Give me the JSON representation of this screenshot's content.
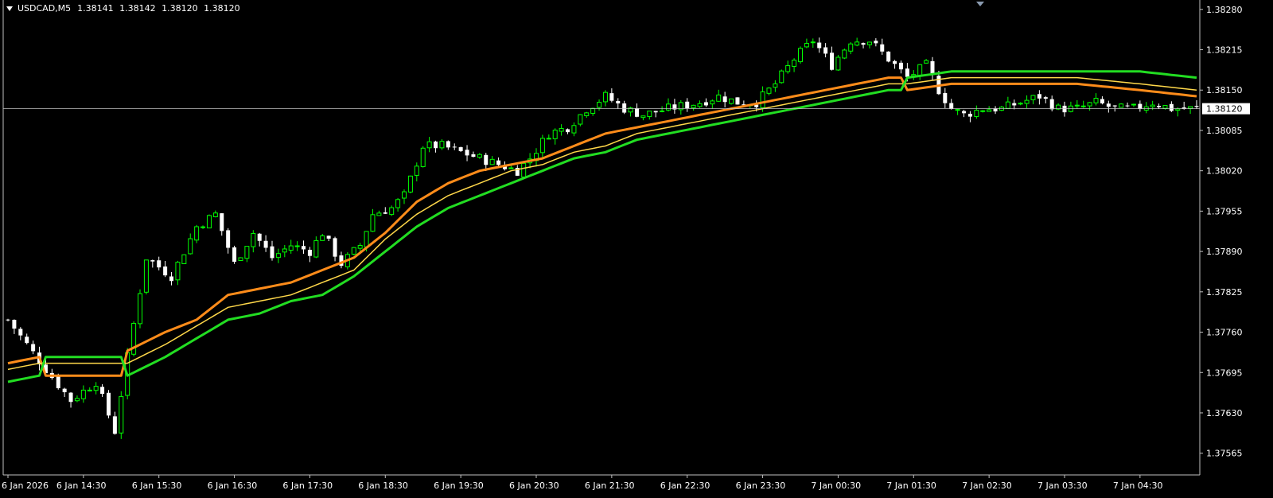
{
  "header": {
    "symbol": "USDCAD,M5",
    "open": "1.38141",
    "high": "1.38142",
    "low": "1.38120",
    "close": "1.38120"
  },
  "colors": {
    "background": "#000000",
    "bull_candle": "#00ff00",
    "bear_candle": "#ffffff",
    "axis": "#c0c0c0",
    "price_line": "#c0c0c0",
    "band_upper": "#ff8c1a",
    "band_middle": "#ffd84a",
    "band_lower": "#22dd22"
  },
  "chart_data": {
    "type": "candlestick",
    "symbol": "USDCAD",
    "timeframe": "M5",
    "ylim": [
      1.3753,
      1.3829
    ],
    "y_ticks": [
      "1.38280",
      "1.38215",
      "1.38150",
      "1.38085",
      "1.38020",
      "1.37955",
      "1.37890",
      "1.37825",
      "1.37760",
      "1.37695",
      "1.37630",
      "1.37565"
    ],
    "y_tick_values": [
      1.3828,
      1.38215,
      1.3815,
      1.38085,
      1.3802,
      1.37955,
      1.3789,
      1.37825,
      1.3776,
      1.37695,
      1.3763,
      1.37565
    ],
    "current_price": 1.3812,
    "current_price_label": "1.38120",
    "x_labels": [
      "6 Jan 2026",
      "6 Jan 14:30",
      "6 Jan 15:30",
      "6 Jan 16:30",
      "6 Jan 17:30",
      "6 Jan 18:30",
      "6 Jan 19:30",
      "6 Jan 20:30",
      "6 Jan 21:30",
      "6 Jan 22:30",
      "6 Jan 23:30",
      "7 Jan 00:30",
      "7 Jan 01:30",
      "7 Jan 02:30",
      "7 Jan 03:30",
      "7 Jan 04:30"
    ],
    "bar_count": 190,
    "ohlc_close_path": [
      [
        0,
        1.3778
      ],
      [
        6,
        1.377
      ],
      [
        10,
        1.3765
      ],
      [
        14,
        1.3768
      ],
      [
        17,
        1.376
      ],
      [
        19,
        1.3772
      ],
      [
        22,
        1.3788
      ],
      [
        26,
        1.3785
      ],
      [
        30,
        1.3793
      ],
      [
        33,
        1.3795
      ],
      [
        36,
        1.3787
      ],
      [
        39,
        1.3792
      ],
      [
        42,
        1.3788
      ],
      [
        45,
        1.379
      ],
      [
        48,
        1.3789
      ],
      [
        50,
        1.3792
      ],
      [
        53,
        1.3787
      ],
      [
        56,
        1.379
      ],
      [
        58,
        1.3795
      ],
      [
        61,
        1.3796
      ],
      [
        63,
        1.3798
      ],
      [
        66,
        1.3806
      ],
      [
        69,
        1.3806
      ],
      [
        72,
        1.3805
      ],
      [
        75,
        1.3804
      ],
      [
        78,
        1.3803
      ],
      [
        81,
        1.3802
      ],
      [
        83,
        1.3804
      ],
      [
        86,
        1.3808
      ],
      [
        89,
        1.3809
      ],
      [
        92,
        1.3812
      ],
      [
        95,
        1.3814
      ],
      [
        98,
        1.3812
      ],
      [
        101,
        1.3811
      ],
      [
        105,
        1.3812
      ],
      [
        110,
        1.3813
      ],
      [
        113,
        1.3814
      ],
      [
        116,
        1.3813
      ],
      [
        119,
        1.3813
      ],
      [
        122,
        1.3816
      ],
      [
        125,
        1.382
      ],
      [
        128,
        1.3823
      ],
      [
        131,
        1.3819
      ],
      [
        134,
        1.3823
      ],
      [
        137,
        1.3823
      ],
      [
        140,
        1.382
      ],
      [
        143,
        1.3817
      ],
      [
        146,
        1.3819
      ],
      [
        148,
        1.3815
      ],
      [
        150,
        1.3812
      ],
      [
        152,
        1.3811
      ],
      [
        155,
        1.3812
      ],
      [
        158,
        1.3812
      ],
      [
        161,
        1.3813
      ],
      [
        164,
        1.3814
      ],
      [
        167,
        1.3812
      ],
      [
        170,
        1.3812
      ],
      [
        173,
        1.3813
      ],
      [
        176,
        1.3812
      ],
      [
        179,
        1.3812
      ],
      [
        182,
        1.3813
      ],
      [
        185,
        1.3812
      ],
      [
        189,
        1.3812
      ]
    ],
    "series": [
      {
        "name": "",
        "color": "#ff8c1a",
        "values": [
          [
            0,
            1.3771
          ],
          [
            5,
            1.3772
          ],
          [
            6,
            1.3769
          ],
          [
            18,
            1.3769
          ],
          [
            19,
            1.3773
          ],
          [
            25,
            1.3776
          ],
          [
            30,
            1.3778
          ],
          [
            35,
            1.3782
          ],
          [
            40,
            1.3783
          ],
          [
            45,
            1.3784
          ],
          [
            50,
            1.3786
          ],
          [
            55,
            1.3788
          ],
          [
            60,
            1.3792
          ],
          [
            65,
            1.3797
          ],
          [
            70,
            1.38
          ],
          [
            75,
            1.3802
          ],
          [
            80,
            1.3803
          ],
          [
            85,
            1.3804
          ],
          [
            90,
            1.3806
          ],
          [
            95,
            1.3808
          ],
          [
            100,
            1.3809
          ],
          [
            105,
            1.381
          ],
          [
            110,
            1.3811
          ],
          [
            115,
            1.3812
          ],
          [
            120,
            1.3813
          ],
          [
            125,
            1.3814
          ],
          [
            130,
            1.3815
          ],
          [
            135,
            1.3816
          ],
          [
            140,
            1.3817
          ],
          [
            142,
            1.3817
          ],
          [
            143,
            1.3815
          ],
          [
            150,
            1.3816
          ],
          [
            160,
            1.3816
          ],
          [
            170,
            1.3816
          ],
          [
            180,
            1.3815
          ],
          [
            189,
            1.3814
          ]
        ]
      },
      {
        "name": "",
        "color": "#ffd84a",
        "values": [
          [
            0,
            1.377
          ],
          [
            5,
            1.3771
          ],
          [
            10,
            1.3771
          ],
          [
            18,
            1.3771
          ],
          [
            19,
            1.3771
          ],
          [
            25,
            1.3774
          ],
          [
            30,
            1.3777
          ],
          [
            35,
            1.378
          ],
          [
            40,
            1.3781
          ],
          [
            45,
            1.3782
          ],
          [
            50,
            1.3784
          ],
          [
            55,
            1.3786
          ],
          [
            60,
            1.3791
          ],
          [
            65,
            1.3795
          ],
          [
            70,
            1.3798
          ],
          [
            75,
            1.38
          ],
          [
            80,
            1.3802
          ],
          [
            85,
            1.3803
          ],
          [
            90,
            1.3805
          ],
          [
            95,
            1.3806
          ],
          [
            100,
            1.3808
          ],
          [
            105,
            1.3809
          ],
          [
            110,
            1.381
          ],
          [
            115,
            1.3811
          ],
          [
            120,
            1.3812
          ],
          [
            125,
            1.3813
          ],
          [
            130,
            1.3814
          ],
          [
            135,
            1.3815
          ],
          [
            140,
            1.3816
          ],
          [
            143,
            1.3816
          ],
          [
            150,
            1.3817
          ],
          [
            160,
            1.3817
          ],
          [
            170,
            1.3817
          ],
          [
            180,
            1.3816
          ],
          [
            189,
            1.3815
          ]
        ]
      },
      {
        "name": "",
        "color": "#22dd22",
        "values": [
          [
            0,
            1.3768
          ],
          [
            5,
            1.3769
          ],
          [
            6,
            1.3772
          ],
          [
            18,
            1.3772
          ],
          [
            19,
            1.3769
          ],
          [
            25,
            1.3772
          ],
          [
            30,
            1.3775
          ],
          [
            35,
            1.3778
          ],
          [
            40,
            1.3779
          ],
          [
            45,
            1.3781
          ],
          [
            50,
            1.3782
          ],
          [
            55,
            1.3785
          ],
          [
            60,
            1.3789
          ],
          [
            65,
            1.3793
          ],
          [
            70,
            1.3796
          ],
          [
            75,
            1.3798
          ],
          [
            80,
            1.38
          ],
          [
            85,
            1.3802
          ],
          [
            90,
            1.3804
          ],
          [
            95,
            1.3805
          ],
          [
            100,
            1.3807
          ],
          [
            105,
            1.3808
          ],
          [
            110,
            1.3809
          ],
          [
            115,
            1.381
          ],
          [
            120,
            1.3811
          ],
          [
            125,
            1.3812
          ],
          [
            130,
            1.3813
          ],
          [
            135,
            1.3814
          ],
          [
            140,
            1.3815
          ],
          [
            142,
            1.3815
          ],
          [
            143,
            1.3817
          ],
          [
            150,
            1.3818
          ],
          [
            160,
            1.3818
          ],
          [
            170,
            1.3818
          ],
          [
            180,
            1.3818
          ],
          [
            189,
            1.3817
          ]
        ]
      }
    ]
  }
}
